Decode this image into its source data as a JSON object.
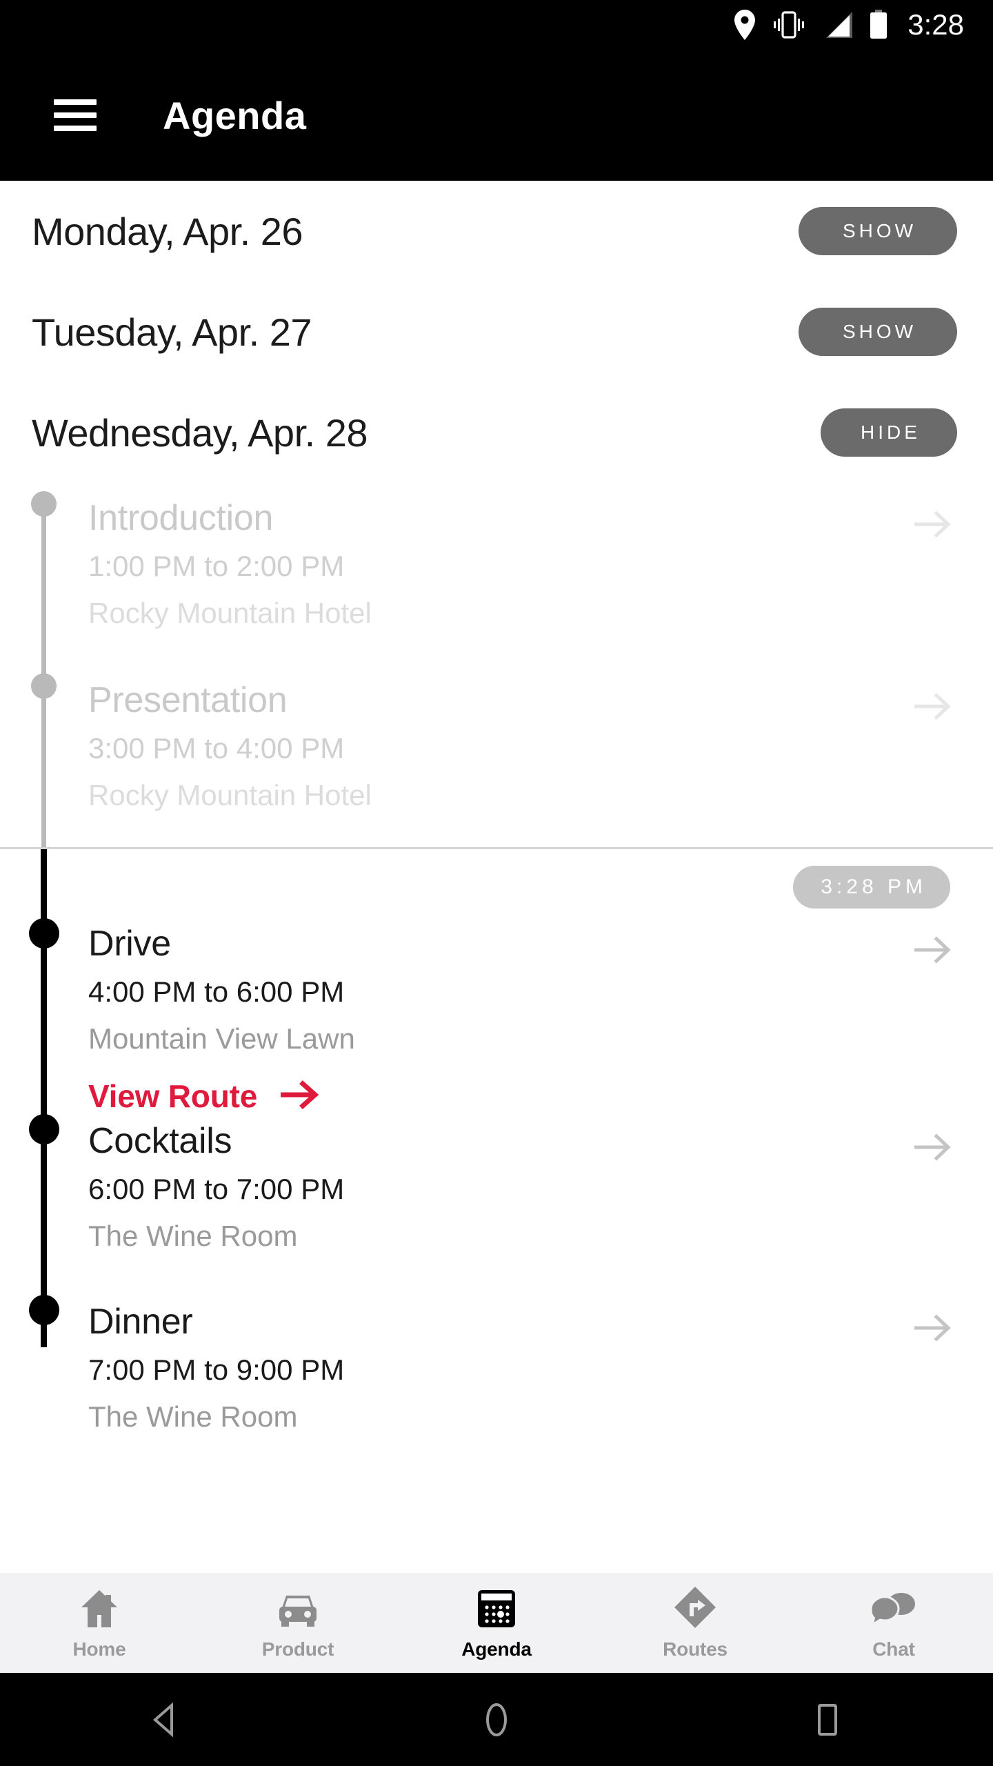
{
  "statusbar": {
    "time": "3:28",
    "icons": [
      "location-pin-icon",
      "vibrate-icon",
      "signal-icon",
      "battery-icon"
    ]
  },
  "appbar": {
    "menu_icon": "hamburger-menu-icon",
    "title": "Agenda"
  },
  "days": [
    {
      "label": "Monday, Apr. 26",
      "toggle": "SHOW",
      "expanded": false
    },
    {
      "label": "Tuesday, Apr. 27",
      "toggle": "SHOW",
      "expanded": false
    },
    {
      "label": "Wednesday, Apr. 28",
      "toggle": "HIDE",
      "expanded": true
    }
  ],
  "current_time_badge": "3:28 PM",
  "events": [
    {
      "title": "Introduction",
      "time": "1:00 PM to 2:00 PM",
      "location": "Rocky Mountain Hotel",
      "state": "past"
    },
    {
      "title": "Presentation",
      "time": "3:00 PM to 4:00 PM",
      "location": "Rocky Mountain Hotel",
      "state": "past"
    },
    {
      "title": "Drive",
      "time": "4:00 PM to 6:00 PM",
      "location": "Mountain View Lawn",
      "state": "current",
      "action_label": "View Route"
    },
    {
      "title": "Cocktails",
      "time": "6:00 PM to 7:00 PM",
      "location": "The Wine Room",
      "state": "current"
    },
    {
      "title": "Dinner",
      "time": "7:00 PM to 9:00 PM",
      "location": "The Wine Room",
      "state": "current"
    }
  ],
  "bottom_nav": [
    {
      "label": "Home",
      "icon": "house-icon",
      "active": false
    },
    {
      "label": "Product",
      "icon": "car-icon",
      "active": false
    },
    {
      "label": "Agenda",
      "icon": "calendar-icon",
      "active": true
    },
    {
      "label": "Routes",
      "icon": "route-diamond-icon",
      "active": false
    },
    {
      "label": "Chat",
      "icon": "chat-bubbles-icon",
      "active": false
    }
  ],
  "android_nav": [
    {
      "label": "back-button",
      "icon": "triangle-back-icon"
    },
    {
      "label": "home-button",
      "icon": "circle-home-icon"
    },
    {
      "label": "recents-button",
      "icon": "square-recents-icon"
    }
  ],
  "colors": {
    "accent_red": "#E01A3C",
    "pill_gray": "#6B6B6B",
    "badge_gray": "#C6C6C6",
    "nav_bg": "#F2F2F4",
    "bar_black": "#000000"
  }
}
